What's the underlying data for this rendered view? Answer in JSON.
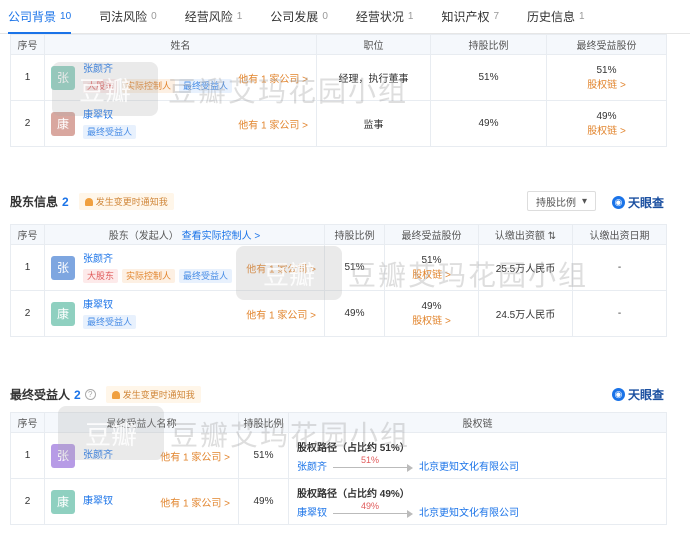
{
  "tabs": [
    {
      "label": "公司背景",
      "count": "10"
    },
    {
      "label": "司法风险",
      "count": "0"
    },
    {
      "label": "经营风险",
      "count": "1"
    },
    {
      "label": "公司发展",
      "count": "0"
    },
    {
      "label": "经营状况",
      "count": "1"
    },
    {
      "label": "知识产权",
      "count": "7"
    },
    {
      "label": "历史信息",
      "count": "1"
    }
  ],
  "members": {
    "headers": [
      "序号",
      "姓名",
      "职位",
      "持股比例",
      "最终受益股份"
    ],
    "rows": [
      {
        "index": "1",
        "avatar": "张",
        "name": "张颜齐",
        "tags": [
          "大股东",
          "实际控制人",
          "最终受益人"
        ],
        "holds": "他有 1 家公司 >",
        "position": "经理，执行董事",
        "ratio": "51%",
        "benefit": "51%",
        "chain": "股权链 >"
      },
      {
        "index": "2",
        "avatar": "康",
        "name": "康翠钗",
        "tags": [
          "最终受益人"
        ],
        "holds": "他有 1 家公司 >",
        "position": "监事",
        "ratio": "49%",
        "benefit": "49%",
        "chain": "股权链 >"
      }
    ]
  },
  "shareholders": {
    "title": "股东信息",
    "count": "2",
    "notice": "发生变更时通知我",
    "sort_label": "持股比例",
    "brand": "天眼查",
    "headers": [
      "序号",
      "股东（发起人）",
      "查看实际控制人 >",
      "持股比例",
      "最终受益股份",
      "认缴出资额",
      "认缴出资日期"
    ],
    "rows": [
      {
        "index": "1",
        "avatar": "张",
        "name": "张颜齐",
        "tags": [
          "大股东",
          "实际控制人",
          "最终受益人"
        ],
        "holds": "他有 1 家公司 >",
        "ratio": "51%",
        "benefit": "51%",
        "chain": "股权链 >",
        "capital": "25.5万人民币",
        "date": "-"
      },
      {
        "index": "2",
        "avatar": "康",
        "name": "康翠钗",
        "tags": [
          "最终受益人"
        ],
        "holds": "他有 1 家公司 >",
        "ratio": "49%",
        "benefit": "49%",
        "chain": "股权链 >",
        "capital": "24.5万人民币",
        "date": "-"
      }
    ]
  },
  "beneficiaries": {
    "title": "最终受益人",
    "count": "2",
    "notice": "发生变更时通知我",
    "brand": "天眼查",
    "headers": [
      "序号",
      "最终受益人名称",
      "持股比例",
      "股权链"
    ],
    "rows": [
      {
        "index": "1",
        "avatar": "张",
        "name": "张颜齐",
        "holds": "他有 1 家公司 >",
        "ratio": "51%",
        "chain_title": "股权路径（占比约 51%）",
        "chain_from": "张颜齐",
        "chain_pct": "51%",
        "chain_to": "北京更知文化有限公司"
      },
      {
        "index": "2",
        "avatar": "康",
        "name": "康翠钗",
        "holds": "他有 1 家公司 >",
        "ratio": "49%",
        "chain_title": "股权路径（占比约 49%）",
        "chain_from": "康翠钗",
        "chain_pct": "49%",
        "chain_to": "北京更知文化有限公司"
      }
    ]
  },
  "watermark": {
    "badge": "豆瓣",
    "text": "豆瓣艾玛花园小组"
  }
}
